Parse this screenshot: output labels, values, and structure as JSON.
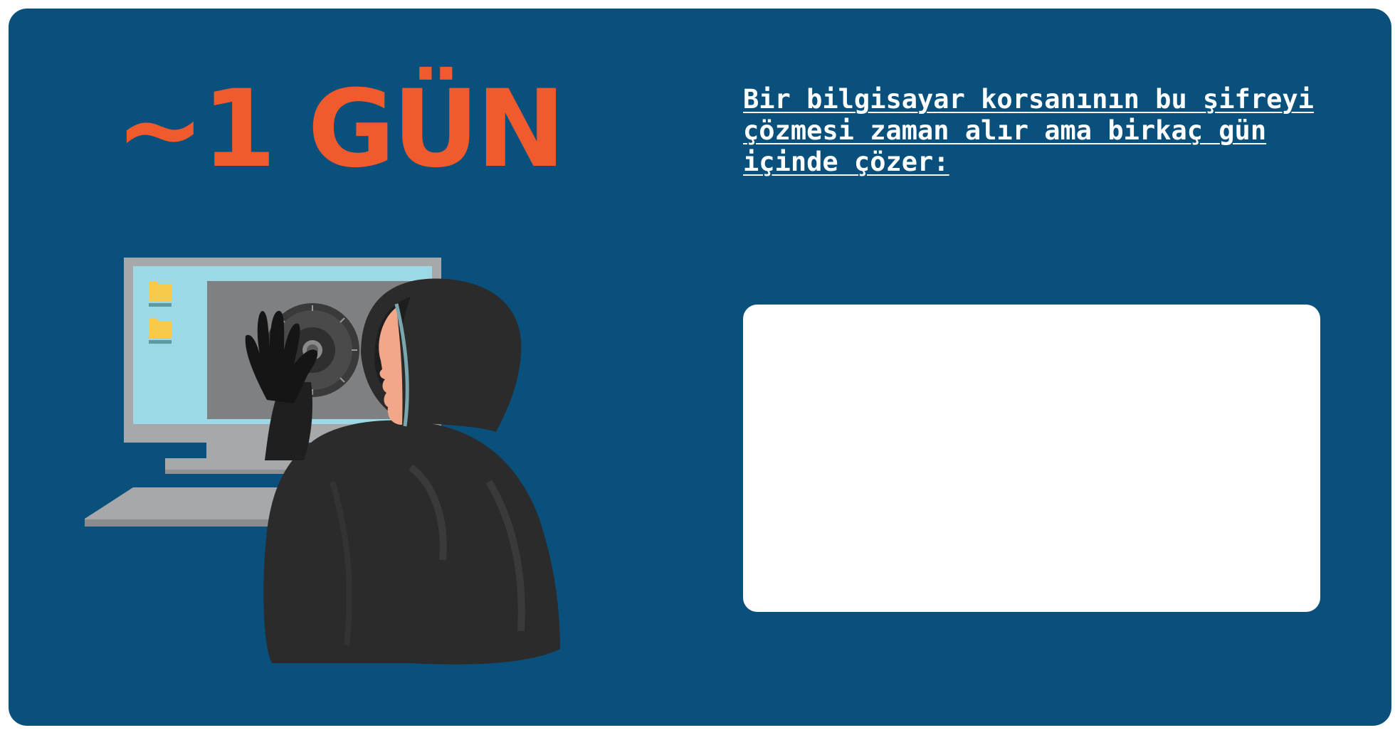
{
  "card": {
    "heading": "~1 GÜN",
    "message": "Bir bilgisayar korsanının bu şifreyi çözmesi zaman alır ama birkaç gün içinde çözer:"
  },
  "colors": {
    "background": "#0a507c",
    "accent": "#f05a2c",
    "panel": "#ffffff"
  },
  "illustration": {
    "icons": [
      "monitor-icon",
      "folder-icon",
      "folder-icon",
      "safe-dial-icon",
      "keyboard-icon",
      "hooded-hacker-icon"
    ]
  }
}
